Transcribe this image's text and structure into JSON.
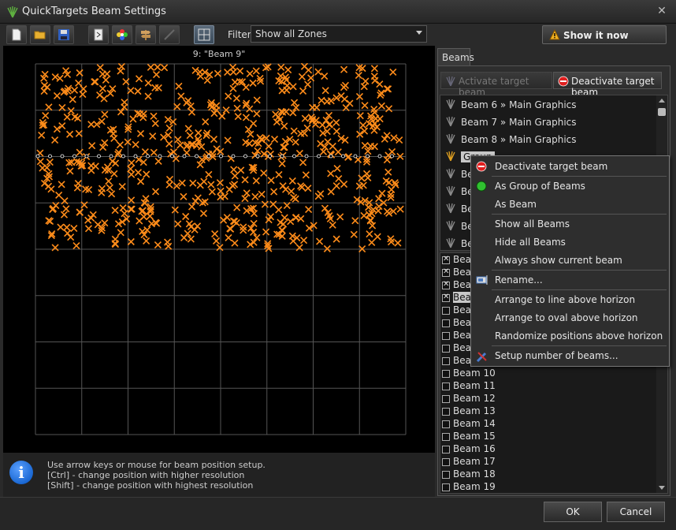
{
  "window": {
    "title": "QuickTargets Beam Settings",
    "close_glyph": "✕"
  },
  "toolbar": {
    "buttons": [
      "new-file-icon",
      "open-folder-icon",
      "save-disk-icon",
      "export-icon",
      "color-wheel-icon",
      "signpost-icon",
      "laser-wand-icon",
      "grid-view-icon"
    ],
    "filter_label": "Filter",
    "filter_value": "Show all Zones",
    "show_now_label": "Show it now"
  },
  "canvas": {
    "beam_title": "9: \"Beam 9\"",
    "grid_columns": 8,
    "grid_rows": 8,
    "marker_color": "#ff8c1a"
  },
  "info": {
    "lines": [
      "Use arrow keys or mouse for beam position setup.",
      "[Ctrl] - change position with higher resolution",
      "[Shift] - change position with highest resolution"
    ]
  },
  "beams_panel": {
    "tab_label": "Beams",
    "activate_label": "Activate target beam",
    "deactivate_label": "Deactivate target beam",
    "groups": [
      {
        "label": "Beam 6 » Main Graphics",
        "selected": false
      },
      {
        "label": "Beam 7 » Main Graphics",
        "selected": false
      },
      {
        "label": "Beam 8 » Main Graphics",
        "selected": false
      },
      {
        "label": "Group",
        "selected": true
      },
      {
        "label": "Be",
        "selected": false
      },
      {
        "label": "Be",
        "selected": false
      },
      {
        "label": "Be",
        "selected": false
      },
      {
        "label": "Be",
        "selected": false
      },
      {
        "label": "Be",
        "selected": false
      }
    ],
    "beams": [
      {
        "label": "Beam",
        "checked": true,
        "selected": false
      },
      {
        "label": "Beam",
        "checked": true,
        "selected": false
      },
      {
        "label": "Beam",
        "checked": true,
        "selected": false
      },
      {
        "label": "Beam",
        "checked": true,
        "selected": true
      },
      {
        "label": "Beam",
        "checked": false,
        "selected": false
      },
      {
        "label": "Beam",
        "checked": false,
        "selected": false
      },
      {
        "label": "Beam",
        "checked": false,
        "selected": false
      },
      {
        "label": "Beam",
        "checked": false,
        "selected": false
      },
      {
        "label": "Beam",
        "checked": false,
        "selected": false
      },
      {
        "label": "Beam 10",
        "checked": false,
        "selected": false
      },
      {
        "label": "Beam 11",
        "checked": false,
        "selected": false
      },
      {
        "label": "Beam 12",
        "checked": false,
        "selected": false
      },
      {
        "label": "Beam 13",
        "checked": false,
        "selected": false
      },
      {
        "label": "Beam 14",
        "checked": false,
        "selected": false
      },
      {
        "label": "Beam 15",
        "checked": false,
        "selected": false
      },
      {
        "label": "Beam 16",
        "checked": false,
        "selected": false
      },
      {
        "label": "Beam 17",
        "checked": false,
        "selected": false
      },
      {
        "label": "Beam 18",
        "checked": false,
        "selected": false
      },
      {
        "label": "Beam 19",
        "checked": false,
        "selected": false
      }
    ]
  },
  "context_menu": {
    "items": [
      {
        "label": "Deactivate target beam",
        "icon": "stop-sign-icon"
      },
      {
        "label": "As Group of Beams",
        "icon": "green-dot-icon"
      },
      {
        "label": "As Beam",
        "icon": ""
      },
      {
        "label": "Show all Beams",
        "icon": ""
      },
      {
        "label": "Hide all Beams",
        "icon": ""
      },
      {
        "label": "Always show current beam",
        "icon": ""
      },
      {
        "label": "Rename...",
        "icon": "rename-icon"
      },
      {
        "label": "Arrange to line above horizon",
        "icon": ""
      },
      {
        "label": "Arrange to oval above horizon",
        "icon": ""
      },
      {
        "label": "Randomize positions above horizon",
        "icon": ""
      },
      {
        "label": "Setup number of beams...",
        "icon": "tools-icon"
      }
    ]
  },
  "footer": {
    "ok_label": "OK",
    "cancel_label": "Cancel"
  }
}
